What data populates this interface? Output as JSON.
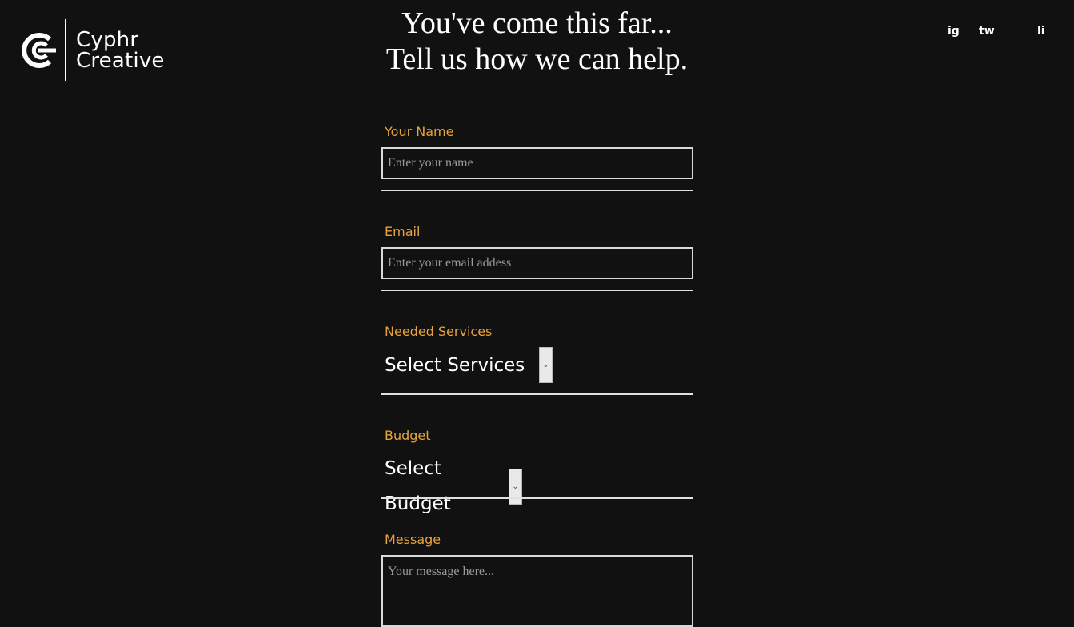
{
  "brand": {
    "line1": "Cyphr",
    "line2": "Creative"
  },
  "social": {
    "instagram": "ig",
    "twitter": "tw",
    "linkedin": "li"
  },
  "headline": {
    "line1": "You've come this far...",
    "line2": "Tell us how we can help."
  },
  "form": {
    "name": {
      "label": "Your Name",
      "placeholder": "Enter your name"
    },
    "email": {
      "label": "Email",
      "placeholder": "Enter your email addess"
    },
    "services": {
      "label": "Needed Services",
      "selected": "Select Services"
    },
    "budget": {
      "label": "Budget",
      "selected": "Select Budget"
    },
    "message": {
      "label": "Message",
      "placeholder": "Your message here..."
    }
  },
  "colors": {
    "background": "#111111",
    "accent": "#e8a33c",
    "text": "#ffffff"
  }
}
